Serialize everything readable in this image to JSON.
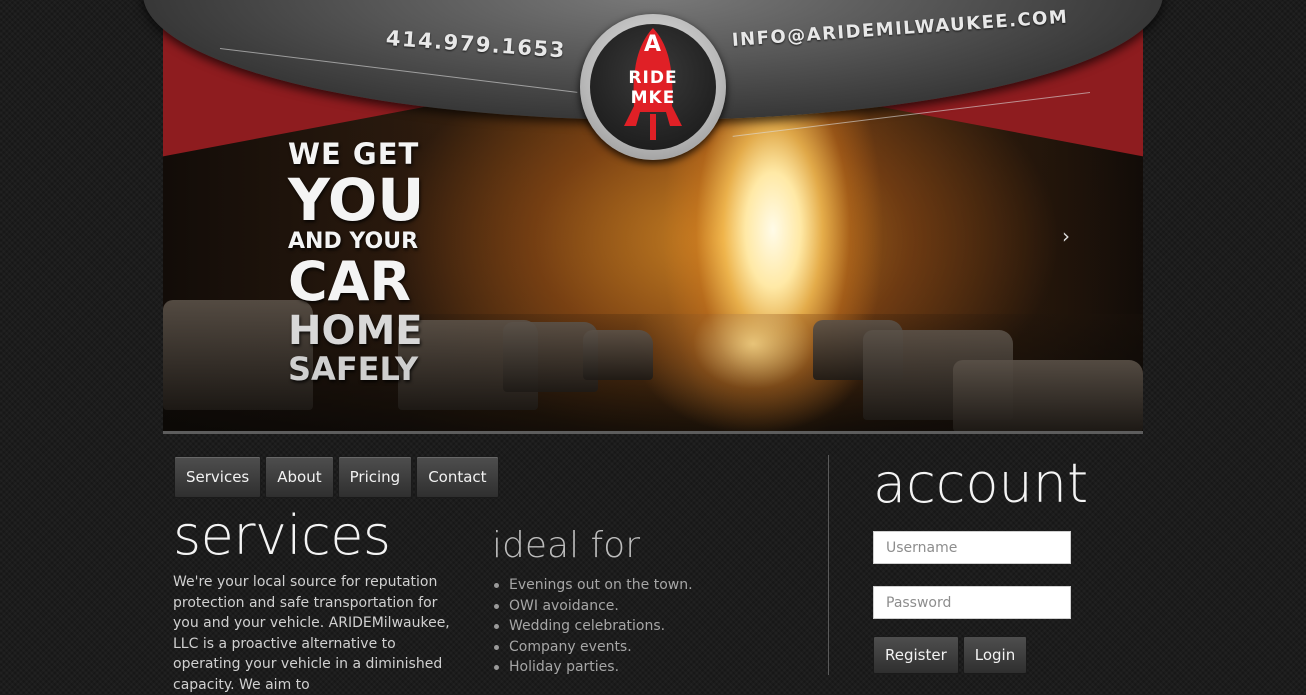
{
  "header": {
    "phone": "414.979.1653",
    "email": "INFO@ARIDEMILWAUKEE.COM",
    "logo_top": "A",
    "logo_mid": "RIDE",
    "logo_bottom": "MKE",
    "logo_icon": "rocket-icon",
    "brand_red": "#8e1c1f"
  },
  "hero": {
    "slogan": [
      "WE GET",
      "YOU",
      "AND YOUR",
      "CAR",
      "HOME",
      "SAFELY"
    ],
    "next_icon": "›"
  },
  "nav": {
    "items": [
      "Services",
      "About",
      "Pricing",
      "Contact"
    ]
  },
  "services": {
    "heading": "services",
    "body": "We're your local source for reputation protection and safe transportation for you and your vehicle. ARIDEMilwaukee, LLC is a proactive alternative to operating your vehicle in a diminished capacity. We aim to"
  },
  "ideal_for": {
    "heading": "ideal for",
    "items": [
      "Evenings out on the town.",
      "OWI avoidance.",
      "Wedding celebrations.",
      "Company events.",
      "Holiday parties."
    ]
  },
  "account": {
    "heading": "account",
    "username_placeholder": "Username",
    "password_placeholder": "Password",
    "register_label": "Register",
    "login_label": "Login"
  }
}
